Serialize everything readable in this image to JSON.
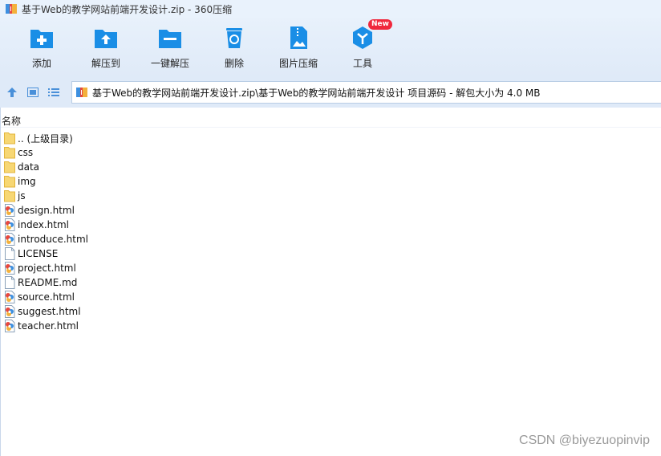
{
  "window": {
    "title": "基于Web的教学网站前端开发设计.zip - 360压缩",
    "icon": "zip-archive-icon"
  },
  "toolbar": {
    "buttons": [
      {
        "label": "添加",
        "icon": "add-icon"
      },
      {
        "label": "解压到",
        "icon": "extract-to-icon"
      },
      {
        "label": "一键解压",
        "icon": "one-click-extract-icon"
      },
      {
        "label": "删除",
        "icon": "delete-icon"
      },
      {
        "label": "图片压缩",
        "icon": "image-compress-icon"
      },
      {
        "label": "工具",
        "icon": "tools-icon",
        "badge": "New"
      }
    ]
  },
  "navbar": {
    "path": "基于Web的教学网站前端开发设计.zip\\基于Web的教学网站前端开发设计 项目源码 - 解包大小为 4.0 MB"
  },
  "list": {
    "column_header": "名称",
    "items": [
      {
        "name": ".. (上级目录)",
        "type": "folder"
      },
      {
        "name": "css",
        "type": "folder"
      },
      {
        "name": "data",
        "type": "folder"
      },
      {
        "name": "img",
        "type": "folder"
      },
      {
        "name": "js",
        "type": "folder"
      },
      {
        "name": "design.html",
        "type": "html"
      },
      {
        "name": "index.html",
        "type": "html"
      },
      {
        "name": "introduce.html",
        "type": "html"
      },
      {
        "name": "LICENSE",
        "type": "file"
      },
      {
        "name": "project.html",
        "type": "html"
      },
      {
        "name": "README.md",
        "type": "file"
      },
      {
        "name": "source.html",
        "type": "html"
      },
      {
        "name": "suggest.html",
        "type": "html"
      },
      {
        "name": "teacher.html",
        "type": "html"
      }
    ]
  },
  "watermark": "CSDN @biyezuopinvip",
  "colors": {
    "accent_blue": "#1a8ee6",
    "toolbar_bg": "#dfeaf8",
    "badge_red": "#f0283c",
    "folder_yellow": "#f7d774"
  }
}
